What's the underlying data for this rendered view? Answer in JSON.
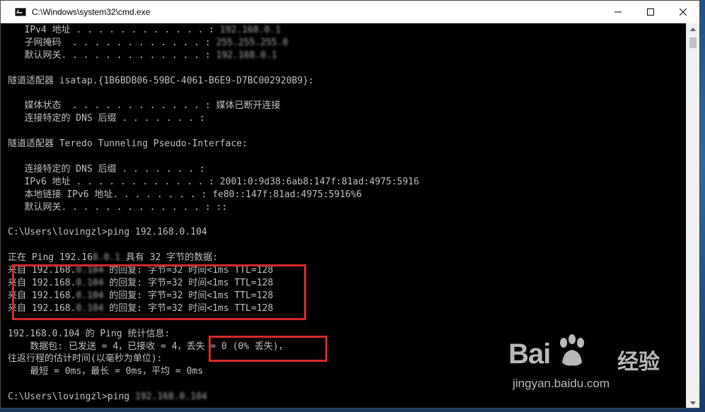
{
  "window": {
    "title": "C:\\Windows\\system32\\cmd.exe",
    "buttons": [
      "minimize",
      "maximize",
      "close"
    ]
  },
  "console": {
    "lines": [
      {
        "pre": "   IPv4 地址 . . . . . . . . . . . . : ",
        "masked": "192.168.0.1",
        "post": ""
      },
      {
        "pre": "   子网掩码  . . . . . . . . . . . . : ",
        "masked": "255.255.255.0",
        "post": ""
      },
      {
        "pre": "   默认网关. . . . . . . . . . . . . : ",
        "masked": "192.168.0.1",
        "post": ""
      },
      {
        "pre": "",
        "masked": "",
        "post": ""
      },
      {
        "pre": "隧道适配器 isatap.{1B6BDB06-59BC-4061-B6E9-D7BC002920B9}:",
        "masked": "",
        "post": ""
      },
      {
        "pre": "",
        "masked": "",
        "post": ""
      },
      {
        "pre": "   媒体状态  . . . . . . . . . . . . : 媒体已断开连接",
        "masked": "",
        "post": ""
      },
      {
        "pre": "   连接特定的 DNS 后缀 . . . . . . . :",
        "masked": "",
        "post": ""
      },
      {
        "pre": "",
        "masked": "",
        "post": ""
      },
      {
        "pre": "隧道适配器 Teredo Tunneling Pseudo-Interface:",
        "masked": "",
        "post": ""
      },
      {
        "pre": "",
        "masked": "",
        "post": ""
      },
      {
        "pre": "   连接特定的 DNS 后缀 . . . . . . . :",
        "masked": "",
        "post": ""
      },
      {
        "pre": "   IPv6 地址 . . . . . . . . . . . . : 2001:0:9d38:6ab8:147f:81ad:4975:5916",
        "masked": "",
        "post": ""
      },
      {
        "pre": "   本地链接 IPv6 地址. . . . . . . . : fe80::147f:81ad:4975:5916%6",
        "masked": "",
        "post": ""
      },
      {
        "pre": "   默认网关. . . . . . . . . . . . . : ::",
        "masked": "",
        "post": ""
      },
      {
        "pre": "",
        "masked": "",
        "post": ""
      },
      {
        "pre": "C:\\Users\\lovingzl>ping 192.168.0.104",
        "masked": "",
        "post": ""
      },
      {
        "pre": "",
        "masked": "",
        "post": ""
      },
      {
        "pre": "正在 Ping 192.16",
        "masked": "8.0.1",
        "post": " 具有 32 字节的数据:"
      },
      {
        "pre": "来自 192.168.",
        "masked": "0.104",
        "post": " 的回复: 字节=32 时间<1ms TTL=128"
      },
      {
        "pre": "来自 192.168.",
        "masked": "0.104",
        "post": " 的回复: 字节=32 时间<1ms TTL=128"
      },
      {
        "pre": "来自 192.168.",
        "masked": "0.104",
        "post": " 的回复: 字节=32 时间<1ms TTL=128"
      },
      {
        "pre": "来自 192.168.",
        "masked": "0.104",
        "post": " 的回复: 字节=32 时间<1ms TTL=128"
      },
      {
        "pre": "",
        "masked": "",
        "post": ""
      },
      {
        "pre": "192.168.0.104 的 Ping 统计信息:",
        "masked": "",
        "post": ""
      },
      {
        "pre": "    数据包: 已发送 = 4，已接收 = 4，丢失 = 0 (0% 丢失)，",
        "masked": "",
        "post": ""
      },
      {
        "pre": "往返行程的估计时间(以毫秒为单位):",
        "masked": "",
        "post": ""
      },
      {
        "pre": "    最短 = 0ms，最长 = 0ms，平均 = 0ms",
        "masked": "",
        "post": ""
      },
      {
        "pre": "",
        "masked": "",
        "post": ""
      },
      {
        "pre": "C:\\Users\\lovingzl>ping ",
        "masked": "192.168.0.104",
        "post": ""
      }
    ]
  },
  "watermark": {
    "brand": "Bai",
    "suffix": "经验",
    "url": "jingyan.baidu.com"
  },
  "colors": {
    "console_bg": "#000000",
    "console_text": "#c0c0c0",
    "highlight": "#d42a2a"
  }
}
